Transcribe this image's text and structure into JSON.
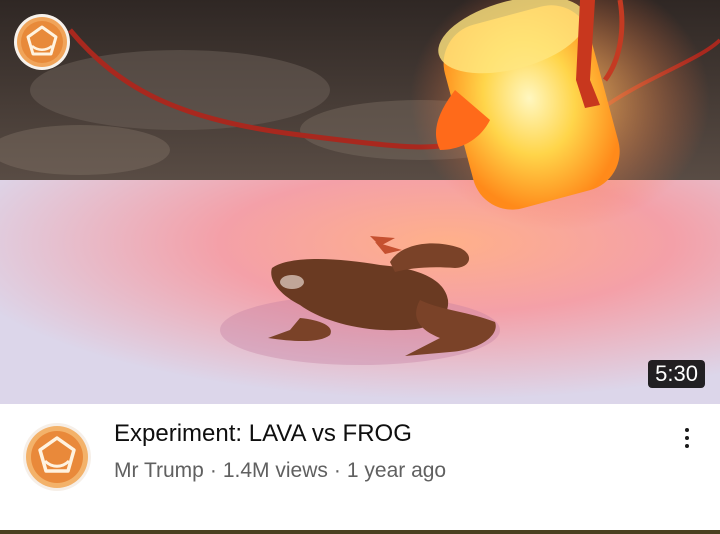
{
  "video": {
    "duration": "5:30",
    "title": "Experiment: LAVA vs FROG",
    "channel": "Mr Trump",
    "views": "1.4M views",
    "age": "1 year ago",
    "separator": "·"
  },
  "icons": {
    "channel_logo": "channel-logo-icon",
    "more": "more-options-icon"
  },
  "colors": {
    "logo_orange": "#f0a45a",
    "title_text": "#0f0f0f",
    "meta_text": "#606060"
  }
}
